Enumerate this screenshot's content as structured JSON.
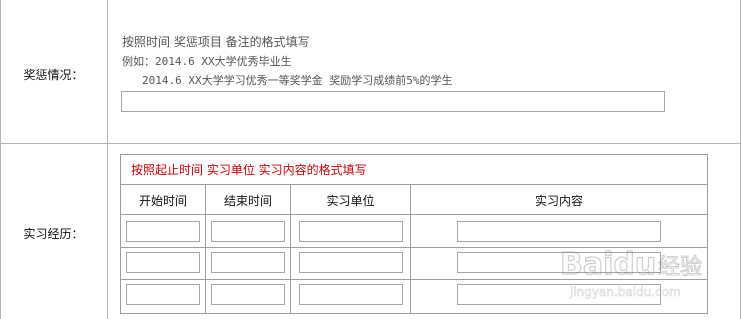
{
  "awards": {
    "label": "奖惩情况：",
    "hint_line1": "按照时间 奖惩项目 备注的格式填写",
    "hint_line2": "例如：2014.6 XX大学优秀毕业生",
    "hint_line3": "2014.6 XX大学学习优秀一等奖学金 奖励学习成绩前5%的学生",
    "input_value": ""
  },
  "internship": {
    "label": "实习经历：",
    "note": "按照起止时间 实习单位 实习内容的格式填写",
    "columns": [
      "开始时间",
      "结束时间",
      "实习单位",
      "实习内容"
    ],
    "rows": [
      {
        "start": "",
        "end": "",
        "company": "",
        "content": ""
      },
      {
        "start": "",
        "end": "",
        "company": "",
        "content": ""
      },
      {
        "start": "",
        "end": "",
        "company": "",
        "content": ""
      }
    ]
  },
  "watermark": {
    "brand": "Baidu",
    "suffix": "经验",
    "url": "jingyan.baidu.com"
  }
}
